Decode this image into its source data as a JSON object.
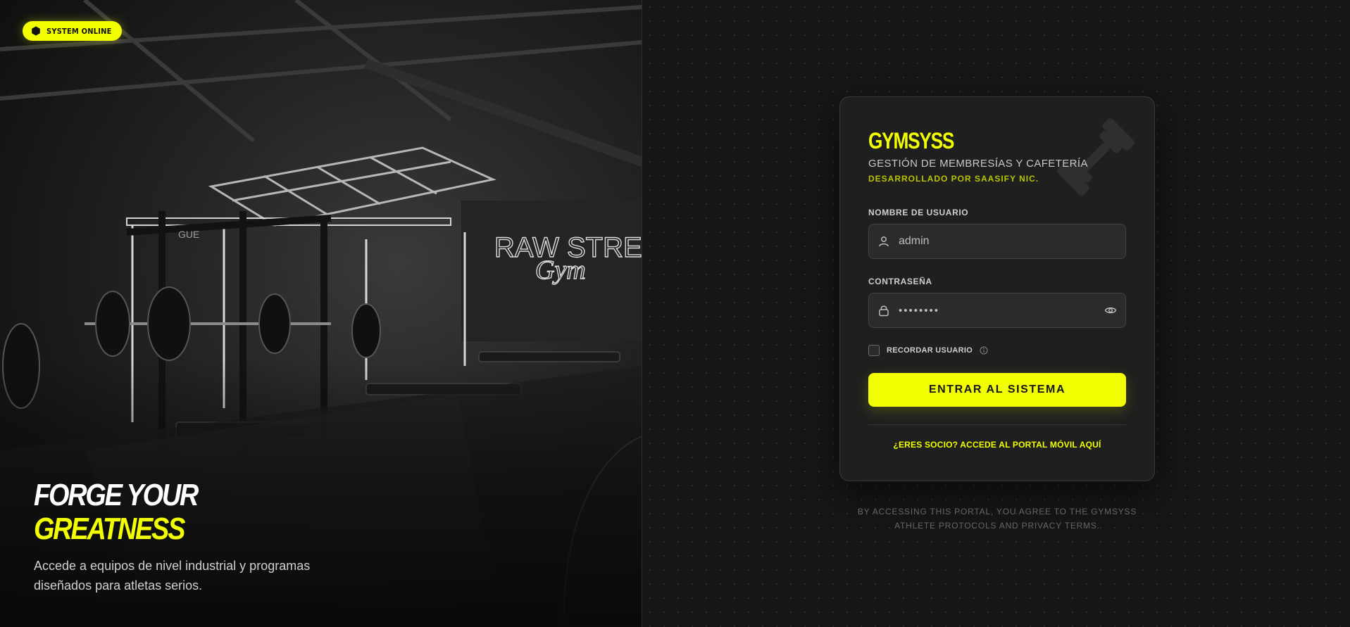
{
  "hero": {
    "status_label": "SYSTEM ONLINE",
    "headline_line1": "FORGE YOUR",
    "headline_line2": "GREATNESS",
    "subtitle": "Accede a equipos de nivel industrial y programas diseñados para atletas serios.",
    "neon_sign_line1": "RAW STRENGTH",
    "neon_sign_line2": "Gym",
    "rack_brand": "GUE"
  },
  "login": {
    "brand": "GYMSYSS",
    "subtitle": "GESTIÓN DE MEMBRESÍAS Y CAFETERÍA",
    "developer": "DESARROLLADO POR SAASIFY NIC.",
    "username_label": "NOMBRE DE USUARIO",
    "username_value": "admin",
    "password_label": "CONTRASEÑA",
    "password_value": "••••••••",
    "remember_label": "RECORDAR USUARIO",
    "submit_label": "ENTRAR AL SISTEMA",
    "member_link": "¿ERES SOCIO? ACCEDE AL PORTAL MÓVIL AQUÍ"
  },
  "footer": {
    "terms_line1": "BY ACCESSING THIS PORTAL, YOU AGREE TO THE GYMSYSS",
    "terms_line2": "ATHLETE PROTOCOLS AND PRIVACY TERMS."
  },
  "icons": {
    "status": "hexagon-icon",
    "watermark": "dumbbell-icon",
    "username": "user-icon",
    "password": "lock-icon",
    "reveal": "eye-icon",
    "remember_info": "info-icon"
  },
  "colors": {
    "accent": "#f2ff00",
    "background": "#161616",
    "card": "#1f1f1f",
    "field": "#2b2b2b"
  }
}
